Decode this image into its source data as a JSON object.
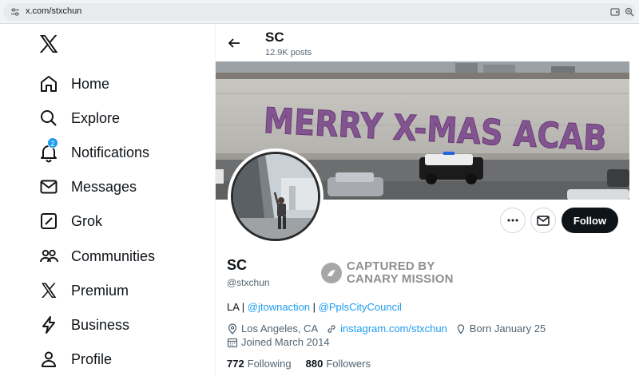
{
  "browser": {
    "url": "x.com/stxchun",
    "icons": [
      "tune-icon",
      "cast-icon",
      "zoom-icon"
    ]
  },
  "sidebar": {
    "logo": "x-logo",
    "items": [
      {
        "label": "Home",
        "icon": "home-icon"
      },
      {
        "label": "Explore",
        "icon": "search-icon"
      },
      {
        "label": "Notifications",
        "icon": "bell-icon",
        "badge": "2"
      },
      {
        "label": "Messages",
        "icon": "mail-icon"
      },
      {
        "label": "Grok",
        "icon": "grok-icon"
      },
      {
        "label": "Communities",
        "icon": "people-icon"
      },
      {
        "label": "Premium",
        "icon": "x-icon"
      },
      {
        "label": "Business",
        "icon": "lightning-icon"
      },
      {
        "label": "Profile",
        "icon": "person-icon"
      }
    ]
  },
  "header": {
    "title": "SC",
    "posts": "12.9K posts"
  },
  "banner": {
    "graffiti": "MERRY X-MAS ACAB"
  },
  "actions": {
    "follow_label": "Follow"
  },
  "profile": {
    "name": "SC",
    "handle": "@stxchun",
    "bio": {
      "prefix": "LA | ",
      "link1": "@jtownaction",
      "sep": " | ",
      "link2": "@PplsCityCouncil"
    },
    "location": "Los Angeles, CA",
    "website": "instagram.com/stxchun",
    "born": "Born January 25",
    "joined": "Joined March 2014",
    "following_count": "772",
    "following_label": "Following",
    "followers_count": "880",
    "followers_label": "Followers"
  },
  "watermark": {
    "line1": "CAPTURED BY",
    "line2": "CANARY MISSION"
  },
  "colors": {
    "accent": "#1d9bf0",
    "text": "#0f1419",
    "secondary": "#536471",
    "follow_bg": "#0f1419"
  }
}
